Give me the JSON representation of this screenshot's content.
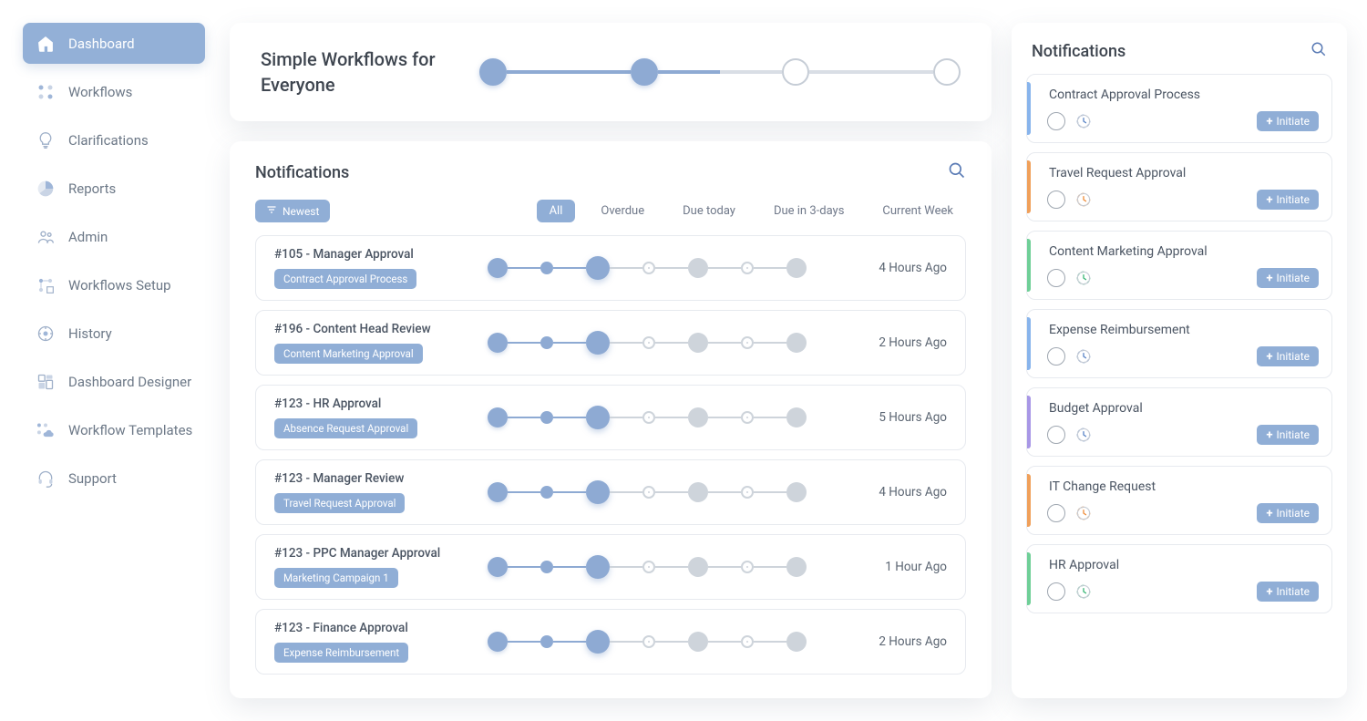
{
  "sidebar": {
    "items": [
      {
        "label": "Dashboard",
        "icon": "home",
        "active": true
      },
      {
        "label": "Workflows",
        "icon": "nodes",
        "active": false
      },
      {
        "label": "Clarifications",
        "icon": "bulb",
        "active": false
      },
      {
        "label": "Reports",
        "icon": "pie",
        "active": false
      },
      {
        "label": "Admin",
        "icon": "people",
        "active": false
      },
      {
        "label": "Workflows Setup",
        "icon": "nodes2",
        "active": false
      },
      {
        "label": "History",
        "icon": "target",
        "active": false
      },
      {
        "label": "Dashboard Designer",
        "icon": "layout",
        "active": false
      },
      {
        "label": "Workflow Templates",
        "icon": "cloudnodes",
        "active": false
      },
      {
        "label": "Support",
        "icon": "headset",
        "active": false
      }
    ]
  },
  "hero": {
    "title": "Simple Workflows for Everyone",
    "steps_total": 4,
    "steps_done": 2
  },
  "notifications": {
    "title": "Notifications",
    "sort_label": "Newest",
    "filters": [
      "All",
      "Overdue",
      "Due today",
      "Due in 3-days",
      "Current Week"
    ],
    "active_filter": "All",
    "items": [
      {
        "title": "#105 - Manager Approval",
        "tag": "Contract Approval Process",
        "time": "4 Hours Ago"
      },
      {
        "title": "#196 - Content Head Review",
        "tag": "Content Marketing Approval",
        "time": "2 Hours Ago"
      },
      {
        "title": "#123 - HR Approval",
        "tag": "Absence Request Approval",
        "time": "5 Hours Ago"
      },
      {
        "title": "#123 - Manager Review",
        "tag": "Travel Request Approval",
        "time": "4 Hours Ago"
      },
      {
        "title": "#123 - PPC Manager Approval",
        "tag": "Marketing Campaign 1",
        "time": "1 Hour Ago"
      },
      {
        "title": "#123 - Finance Approval",
        "tag": "Expense Reimbursement",
        "time": "2 Hours Ago"
      }
    ]
  },
  "workflows_panel": {
    "title": "Notifications",
    "initiate_label": "Initiate",
    "items": [
      {
        "title": "Contract Approval Process",
        "stripe": "s-blue",
        "clock": "blue"
      },
      {
        "title": "Travel Request Approval",
        "stripe": "s-orange",
        "clock": "orange"
      },
      {
        "title": "Content Marketing Approval",
        "stripe": "s-green",
        "clock": "green"
      },
      {
        "title": "Expense Reimbursement",
        "stripe": "s-blue",
        "clock": "blue"
      },
      {
        "title": "Budget Approval",
        "stripe": "s-purple",
        "clock": "blue"
      },
      {
        "title": "IT Change Request",
        "stripe": "s-orange",
        "clock": "orange"
      },
      {
        "title": "HR Approval",
        "stripe": "s-green",
        "clock": "green"
      }
    ]
  }
}
